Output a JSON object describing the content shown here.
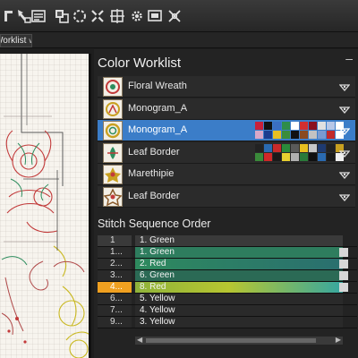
{
  "toolbar": {
    "icons": [
      "pointer-icon",
      "stitch-select-icon",
      "layout-grid-icon",
      "palette-icon",
      "recolor-icon",
      "cross-stitch-icon",
      "settings-gear-icon",
      "screen-icon",
      "close-x-icon"
    ]
  },
  "tabs": {
    "worklist_label": "Worklist"
  },
  "colors": {
    "selected_row": "#3b7dc8",
    "highlight_index": "#f0a020",
    "green": "#2e7d5e",
    "red": "#c22a2a",
    "yellow": "#b7c631"
  },
  "color_worklist": {
    "title": "Color Worklist",
    "items": [
      {
        "label": "Floral Wreath",
        "selected": false
      },
      {
        "label": "Monogram_A",
        "selected": false
      },
      {
        "label": "Monogram_A",
        "selected": true
      },
      {
        "label": "Leaf Border",
        "selected": false
      },
      {
        "label": "Marethipie",
        "selected": false
      },
      {
        "label": "Leaf Border",
        "selected": false
      }
    ],
    "palette_a": [
      "#c8203a",
      "#111111",
      "#3a6fc2",
      "#2e8d4a",
      "#ffffff",
      "#d32f2f",
      "#8a0f1f",
      "#e0e0e0",
      "#b7c7e7",
      "#ffffff",
      "#d8a8c8",
      "#1b3d8f",
      "#e9c020",
      "#3a8d3a",
      "#111111",
      "#8a4a20",
      "#c2c2c2",
      "#7a9ad0",
      "#c22a2a",
      "#ffffff"
    ],
    "palette_b": [
      "#222222",
      "#2a6ab0",
      "#c82a2a",
      "#2a8a3a",
      "#5a5a5a",
      "#e8c020",
      "#c8c8c8",
      "#1e3a70",
      "#222222",
      "#c8a020",
      "#3a8a3a",
      "#d02828",
      "#1a1a1a",
      "#e8d030",
      "#b0b0b0",
      "#2a7a3a",
      "#101010",
      "#2a6ab0",
      "#1a1a1a",
      "#f0f0f0"
    ]
  },
  "stitch_sequence": {
    "title": "Stitch Sequence Order",
    "rows": [
      {
        "index": "1",
        "name": "1. Green"
      },
      {
        "index": "1...",
        "name": "1. Green"
      },
      {
        "index": "2...",
        "name": "2. Red"
      },
      {
        "index": "3...",
        "name": "6. Green"
      },
      {
        "index": "4...",
        "name": "8. Red"
      },
      {
        "index": "6...",
        "name": "5. Yellow"
      },
      {
        "index": "7...",
        "name": "4. Yellow"
      },
      {
        "index": "9...",
        "name": "3. Yellow"
      }
    ]
  }
}
